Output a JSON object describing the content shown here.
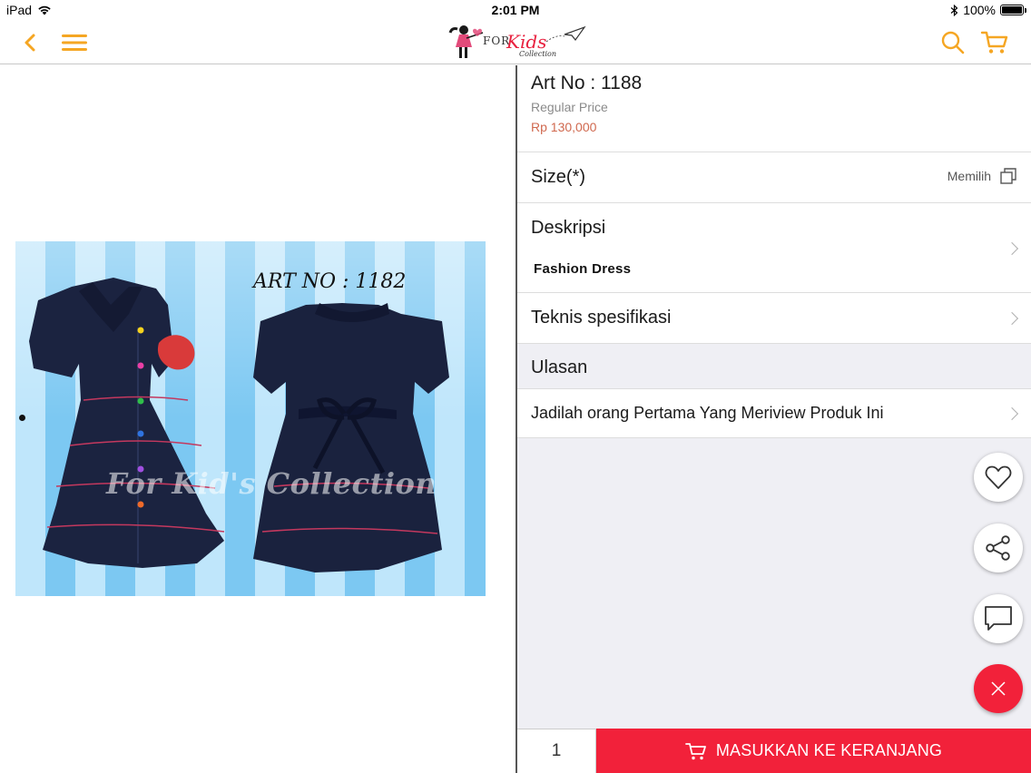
{
  "status_bar": {
    "device": "iPad",
    "time": "2:01 PM",
    "battery": "100%",
    "battery_level": 1.0
  },
  "nav": {
    "logo_text_for": "FOR",
    "logo_text_kids": "Kids",
    "logo_text_collection": "Collection",
    "accent_color": "#f5a623"
  },
  "product_image": {
    "art_label": "ART NO : 1182",
    "watermark": "For Kid's Collection"
  },
  "product": {
    "art_no": "Art No : 1188",
    "price_label": "Regular Price",
    "price_value": "Rp 130,000",
    "price_color": "#d0694f"
  },
  "size": {
    "label": "Size(*)",
    "action": "Memilih"
  },
  "description": {
    "label": "Deskripsi",
    "text": "Fashion Dress"
  },
  "tech_spec": {
    "label": "Teknis spesifikasi"
  },
  "reviews": {
    "header": "Ulasan",
    "prompt": "Jadilah orang Pertama Yang Meriview Produk Ini"
  },
  "cart": {
    "quantity": "1",
    "add_label": "MASUKKAN KE KERANJANG",
    "button_color": "#f2213a"
  }
}
